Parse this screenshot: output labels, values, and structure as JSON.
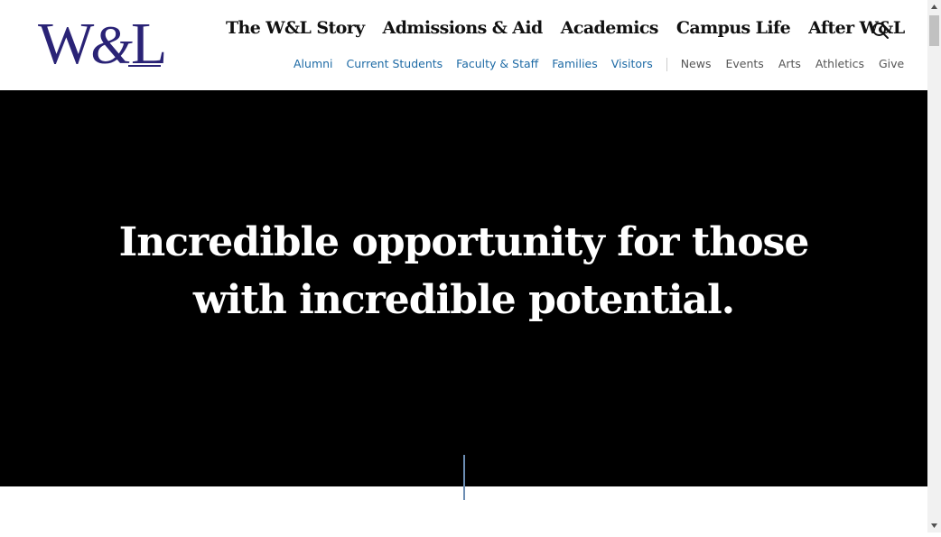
{
  "logo": {
    "w": "W",
    "amp": "&",
    "l": "L"
  },
  "primary_nav": [
    {
      "label": "The W&L Story"
    },
    {
      "label": "Admissions & Aid"
    },
    {
      "label": "Academics"
    },
    {
      "label": "Campus Life"
    },
    {
      "label": "After W&L"
    }
  ],
  "audience_nav": [
    {
      "label": "Alumni"
    },
    {
      "label": "Current Students"
    },
    {
      "label": "Faculty & Staff"
    },
    {
      "label": "Families"
    },
    {
      "label": "Visitors"
    }
  ],
  "utility_nav": [
    {
      "label": "News"
    },
    {
      "label": "Events"
    },
    {
      "label": "Arts"
    },
    {
      "label": "Athletics"
    },
    {
      "label": "Give"
    }
  ],
  "hero": {
    "line1": "Incredible opportunity for those",
    "line2": "with incredible potential."
  },
  "icons": {
    "search": "search-icon",
    "scroll_up": "triangle-up-icon",
    "scroll_down": "triangle-down-icon"
  },
  "colors": {
    "brand": "#2a2376",
    "audience_link": "#1d6aa5",
    "utility_link": "#555555",
    "hero_bg": "#000000",
    "hero_accent_line": "#6c8db3"
  }
}
